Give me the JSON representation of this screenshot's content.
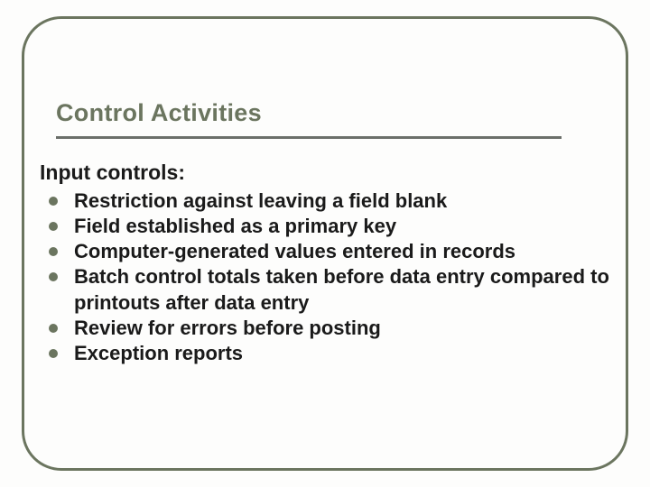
{
  "slide": {
    "title": "Control Activities",
    "subhead": "Input controls:",
    "items": [
      "Restriction against leaving a field blank",
      "Field established as a primary key",
      "Computer-generated values entered in records",
      "Batch control totals taken before data entry compared to printouts after data entry",
      "Review for errors before posting",
      "Exception reports"
    ]
  }
}
